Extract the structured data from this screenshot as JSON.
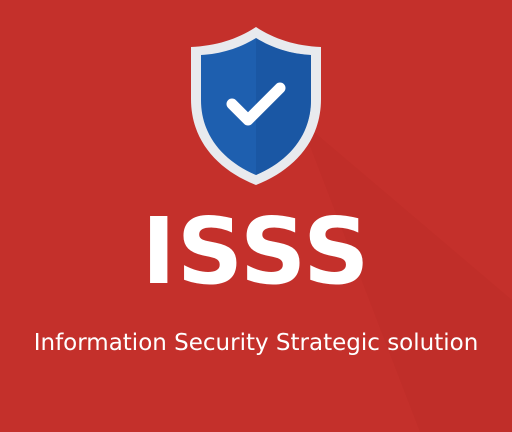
{
  "brand": {
    "title": "ISSS",
    "tagline": "Information Security Strategic solution"
  },
  "logo": {
    "icon": "shield-check-icon"
  },
  "colors": {
    "background": "#c4302b",
    "shield_border": "#e8eaee",
    "shield_fill": "#1e5faf",
    "shield_fill_shadow": "#17509a",
    "check": "#ffffff",
    "text": "#ffffff"
  }
}
